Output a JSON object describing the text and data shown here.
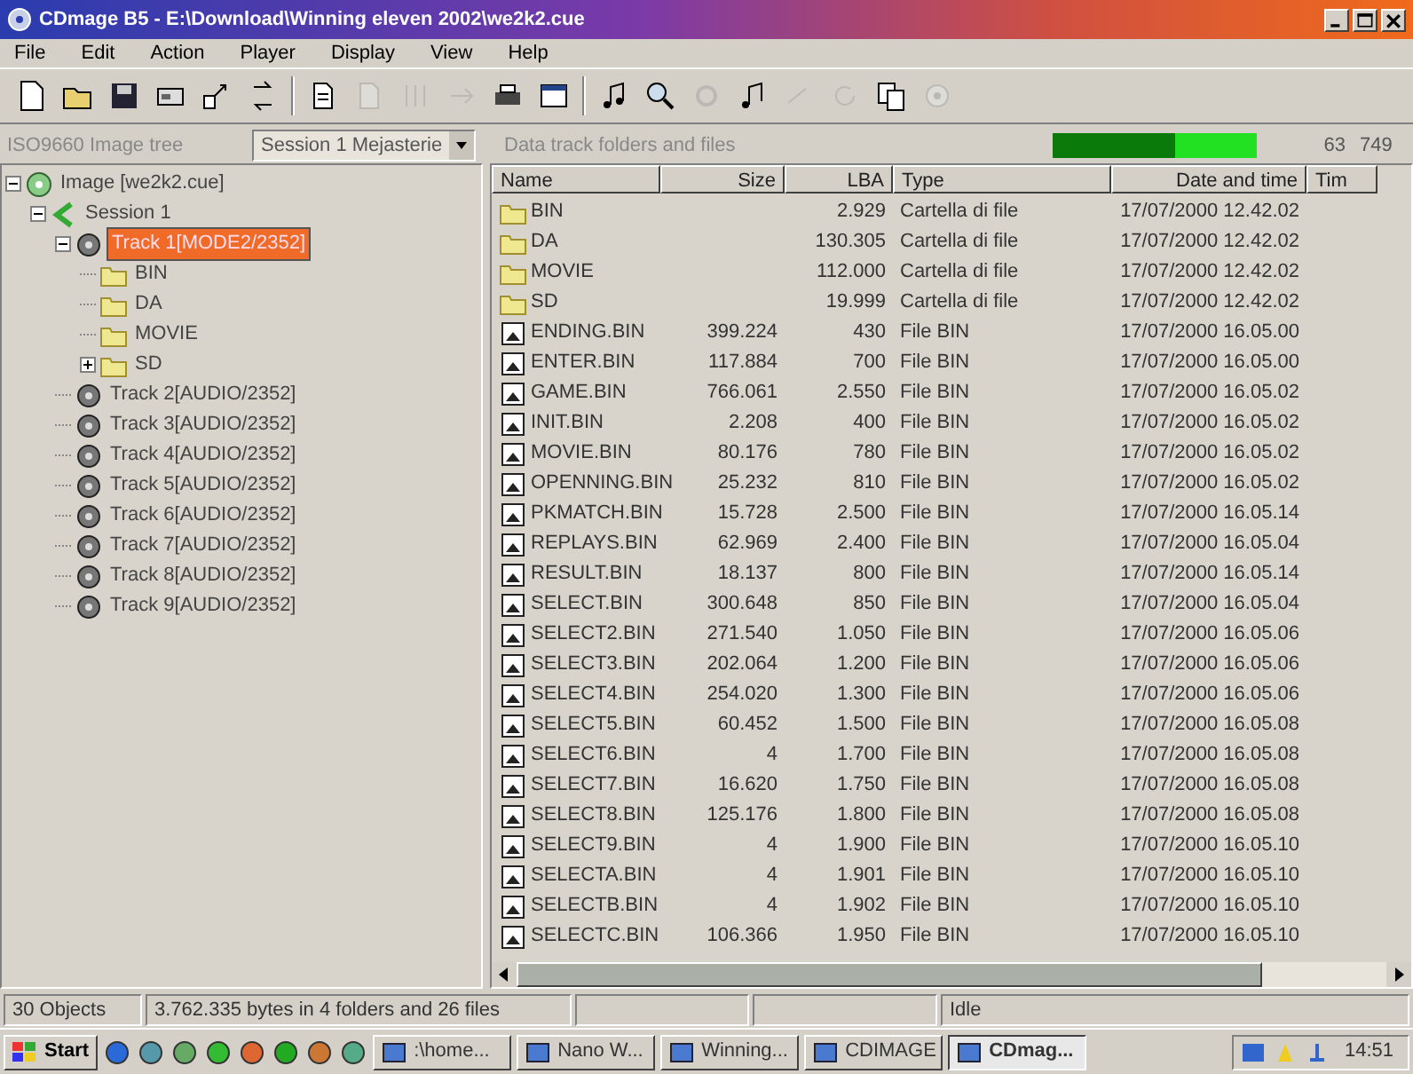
{
  "window": {
    "title": "CDmage B5 - E:\\Download\\Winning eleven 2002\\we2k2.cue"
  },
  "menu": [
    "File",
    "Edit",
    "Action",
    "Player",
    "Display",
    "View",
    "Help"
  ],
  "toolbar": [
    {
      "disabled": false
    },
    {
      "disabled": false
    },
    {
      "disabled": false
    },
    {
      "disabled": false
    },
    {
      "disabled": false
    },
    {
      "disabled": false
    },
    {
      "disabled": false
    },
    {
      "disabled": true
    },
    {
      "disabled": true
    },
    {
      "disabled": true
    },
    {
      "disabled": false
    },
    {
      "disabled": false
    },
    {
      "disabled": false
    },
    {
      "disabled": false
    },
    {
      "disabled": true
    },
    {
      "disabled": false
    },
    {
      "disabled": true
    },
    {
      "disabled": true
    },
    {
      "disabled": false
    },
    {
      "disabled": true
    }
  ],
  "tree_panel": {
    "title": "ISO9660 Image tree",
    "session_select": "Session 1 Mejasterie"
  },
  "tree": [
    {
      "label": "Image [we2k2.cue]",
      "kind": "image",
      "expanded": true,
      "children": [
        {
          "label": "Session 1",
          "kind": "session",
          "expanded": true,
          "children": [
            {
              "label": "Track  1[MODE2/2352]",
              "kind": "track",
              "selected": true,
              "expanded": true,
              "children": [
                {
                  "label": "BIN",
                  "kind": "folder",
                  "selected": false
                },
                {
                  "label": "DA",
                  "kind": "folder",
                  "selected": false
                },
                {
                  "label": "MOVIE",
                  "kind": "folder",
                  "selected": false
                },
                {
                  "label": "SD",
                  "kind": "folder",
                  "selected": false,
                  "expanded": false
                }
              ]
            },
            {
              "label": "Track  2[AUDIO/2352]",
              "kind": "track",
              "selected": false
            },
            {
              "label": "Track  3[AUDIO/2352]",
              "kind": "track",
              "selected": false
            },
            {
              "label": "Track  4[AUDIO/2352]",
              "kind": "track",
              "selected": false
            },
            {
              "label": "Track  5[AUDIO/2352]",
              "kind": "track",
              "selected": false
            },
            {
              "label": "Track  6[AUDIO/2352]",
              "kind": "track",
              "selected": false
            },
            {
              "label": "Track  7[AUDIO/2352]",
              "kind": "track",
              "selected": false
            },
            {
              "label": "Track  8[AUDIO/2352]",
              "kind": "track",
              "selected": false
            },
            {
              "label": "Track  9[AUDIO/2352]",
              "kind": "track",
              "selected": false
            }
          ]
        }
      ]
    }
  ],
  "files_panel": {
    "title": "Data track folders and files",
    "meter": {
      "level": 0.6
    },
    "reading_1": "63",
    "reading_2": "749"
  },
  "table": {
    "columns": [
      "Name",
      "Size",
      "LBA",
      "Type",
      "Date and time",
      "Tim"
    ],
    "rows": [
      {
        "kind": "folder",
        "cells": [
          "BIN",
          "",
          "2.929",
          "Cartella di file",
          "17/07/2000 12.42.02"
        ]
      },
      {
        "kind": "folder",
        "cells": [
          "DA",
          "",
          "130.305",
          "Cartella di file",
          "17/07/2000 12.42.02"
        ]
      },
      {
        "kind": "folder",
        "cells": [
          "MOVIE",
          "",
          "112.000",
          "Cartella di file",
          "17/07/2000 12.42.02"
        ]
      },
      {
        "kind": "folder",
        "cells": [
          "SD",
          "",
          "19.999",
          "Cartella di file",
          "17/07/2000 12.42.02"
        ]
      },
      {
        "kind": "file",
        "cells": [
          "ENDING.BIN",
          "399.224",
          "430",
          "File BIN",
          "17/07/2000 16.05.00"
        ]
      },
      {
        "kind": "file",
        "cells": [
          "ENTER.BIN",
          "117.884",
          "700",
          "File BIN",
          "17/07/2000 16.05.00"
        ]
      },
      {
        "kind": "file",
        "cells": [
          "GAME.BIN",
          "766.061",
          "2.550",
          "File BIN",
          "17/07/2000 16.05.02"
        ]
      },
      {
        "kind": "file",
        "cells": [
          "INIT.BIN",
          "2.208",
          "400",
          "File BIN",
          "17/07/2000 16.05.02"
        ]
      },
      {
        "kind": "file",
        "cells": [
          "MOVIE.BIN",
          "80.176",
          "780",
          "File BIN",
          "17/07/2000 16.05.02"
        ]
      },
      {
        "kind": "file",
        "cells": [
          "OPENNING.BIN",
          "25.232",
          "810",
          "File BIN",
          "17/07/2000 16.05.02"
        ]
      },
      {
        "kind": "file",
        "cells": [
          "PKMATCH.BIN",
          "15.728",
          "2.500",
          "File BIN",
          "17/07/2000 16.05.14"
        ]
      },
      {
        "kind": "file",
        "cells": [
          "REPLAYS.BIN",
          "62.969",
          "2.400",
          "File BIN",
          "17/07/2000 16.05.04"
        ]
      },
      {
        "kind": "file",
        "cells": [
          "RESULT.BIN",
          "18.137",
          "800",
          "File BIN",
          "17/07/2000 16.05.14"
        ]
      },
      {
        "kind": "file",
        "cells": [
          "SELECT.BIN",
          "300.648",
          "850",
          "File BIN",
          "17/07/2000 16.05.04"
        ]
      },
      {
        "kind": "file",
        "cells": [
          "SELECT2.BIN",
          "271.540",
          "1.050",
          "File BIN",
          "17/07/2000 16.05.06"
        ]
      },
      {
        "kind": "file",
        "cells": [
          "SELECT3.BIN",
          "202.064",
          "1.200",
          "File BIN",
          "17/07/2000 16.05.06"
        ]
      },
      {
        "kind": "file",
        "cells": [
          "SELECT4.BIN",
          "254.020",
          "1.300",
          "File BIN",
          "17/07/2000 16.05.06"
        ]
      },
      {
        "kind": "file",
        "cells": [
          "SELECT5.BIN",
          "60.452",
          "1.500",
          "File BIN",
          "17/07/2000 16.05.08"
        ]
      },
      {
        "kind": "file",
        "cells": [
          "SELECT6.BIN",
          "4",
          "1.700",
          "File BIN",
          "17/07/2000 16.05.08"
        ]
      },
      {
        "kind": "file",
        "cells": [
          "SELECT7.BIN",
          "16.620",
          "1.750",
          "File BIN",
          "17/07/2000 16.05.08"
        ]
      },
      {
        "kind": "file",
        "cells": [
          "SELECT8.BIN",
          "125.176",
          "1.800",
          "File BIN",
          "17/07/2000 16.05.08"
        ]
      },
      {
        "kind": "file",
        "cells": [
          "SELECT9.BIN",
          "4",
          "1.900",
          "File BIN",
          "17/07/2000 16.05.10"
        ]
      },
      {
        "kind": "file",
        "cells": [
          "SELECTA.BIN",
          "4",
          "1.901",
          "File BIN",
          "17/07/2000 16.05.10"
        ]
      },
      {
        "kind": "file",
        "cells": [
          "SELECTB.BIN",
          "4",
          "1.902",
          "File BIN",
          "17/07/2000 16.05.10"
        ]
      },
      {
        "kind": "file",
        "cells": [
          "SELECTC.BIN",
          "106.366",
          "1.950",
          "File BIN",
          "17/07/2000 16.05.10"
        ]
      }
    ]
  },
  "status_bar": [
    "30 Objects",
    "3.762.335 bytes in 4 folders and 26 files",
    "Idle"
  ],
  "taskbar": {
    "start": "Start",
    "tasks": [
      {
        "label": ":\\home...",
        "active": false
      },
      {
        "label": "Nano W...",
        "active": false
      },
      {
        "label": "Winning...",
        "active": false
      },
      {
        "label": "CDIMAGE",
        "active": false
      },
      {
        "label": "CDmag...",
        "active": true
      }
    ],
    "clock": "14:51"
  }
}
